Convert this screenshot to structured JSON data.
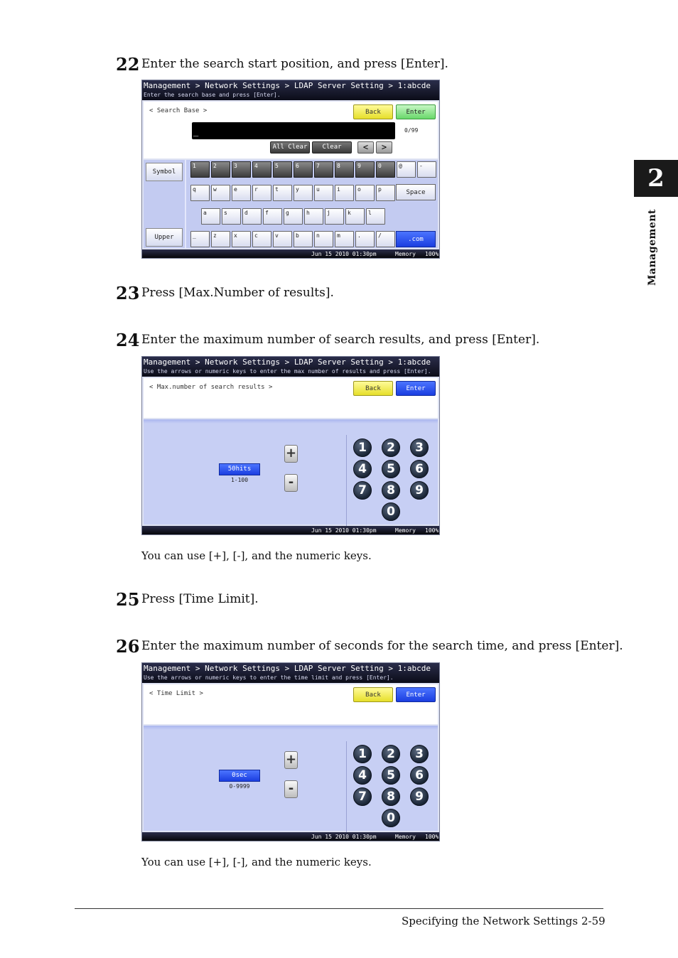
{
  "steps": [
    {
      "number": "22",
      "text": "Enter the search start position, and press [Enter]."
    },
    {
      "number": "23",
      "text": "Press [Max.Number of results]."
    },
    {
      "number": "24",
      "text": "Enter the maximum number of search results, and press [Enter]."
    },
    {
      "number": "25",
      "text": "Press [Time Limit]."
    },
    {
      "number": "26",
      "text": "Enter the maximum number of seconds for the search time, and press [Enter]."
    }
  ],
  "notes": {
    "note1": "You can use [+], [-], and the numeric keys.",
    "note2": "You can use [+], [-], and the numeric keys."
  },
  "side_tab": {
    "number": "2",
    "label": "Management"
  },
  "footer": {
    "title": "Specifying the Network Settings",
    "page": "2-59"
  },
  "common": {
    "breadcrumb": "Management > Network Settings > LDAP Server Setting > 1:abcde",
    "back_label": "Back",
    "enter_label": "Enter",
    "status_date": "Jun 15 2010 01:30pm",
    "status_memory": "Memory",
    "status_pct": "100%"
  },
  "screen1": {
    "instruction": "Enter the search base and press [Enter].",
    "field_label": "< Search Base >",
    "input_value": "_",
    "counter": "0/99",
    "all_clear": "All Clear",
    "clear": "Clear",
    "left_arrow": "<",
    "right_arrow": ">",
    "symbol": "Symbol",
    "upper": "Upper",
    "row1": [
      "1",
      "2",
      "3",
      "4",
      "5",
      "6",
      "7",
      "8",
      "9",
      "0",
      "@",
      "-"
    ],
    "row2": [
      "q",
      "w",
      "e",
      "r",
      "t",
      "y",
      "u",
      "i",
      "o",
      "p"
    ],
    "space": "Space",
    "row3": [
      "a",
      "s",
      "d",
      "f",
      "g",
      "h",
      "j",
      "k",
      "l"
    ],
    "row4": [
      "_",
      "z",
      "x",
      "c",
      "v",
      "b",
      "n",
      "m",
      ".",
      "/"
    ],
    "com": ".com"
  },
  "screen2": {
    "instruction": "Use the arrows or numeric keys to enter the max number of results and press [Enter].",
    "field_label": "< Max.number of search results >",
    "value": "50hits",
    "range": "1-100",
    "plus": "+",
    "minus": "-",
    "keys": [
      "1",
      "2",
      "3",
      "4",
      "5",
      "6",
      "7",
      "8",
      "9",
      "0"
    ]
  },
  "screen3": {
    "instruction": "Use the arrows or numeric keys to enter the time limit and press [Enter].",
    "field_label": "< Time Limit >",
    "value": "0sec",
    "range": "0-9999",
    "plus": "+",
    "minus": "-",
    "keys": [
      "1",
      "2",
      "3",
      "4",
      "5",
      "6",
      "7",
      "8",
      "9",
      "0"
    ]
  },
  "colors": {
    "header_bg": "#0b0c18",
    "back_button": "#e6df2a",
    "enter_green": "#69d86a",
    "enter_blue": "#1b3ee0",
    "panel": "#c3cbf1"
  }
}
